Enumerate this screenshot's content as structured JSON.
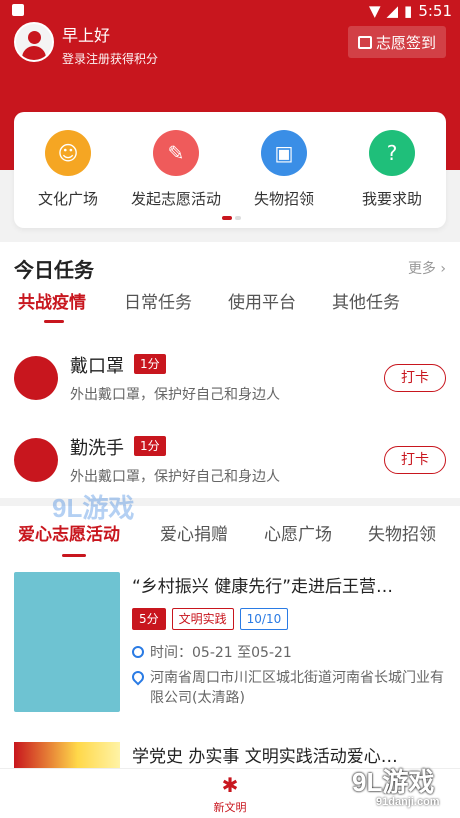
{
  "status": {
    "time": "5:51"
  },
  "header": {
    "greeting": "早上好",
    "subtitle": "登录注册获得积分",
    "sign_in_label": "志愿签到"
  },
  "quick_actions": [
    {
      "label": "文化广场",
      "icon": "chat-bubble-icon",
      "color": "#f5a623"
    },
    {
      "label": "发起志愿活动",
      "icon": "megaphone-icon",
      "color": "#ef5b5b"
    },
    {
      "label": "失物招领",
      "icon": "box-icon",
      "color": "#3a8ee6"
    },
    {
      "label": "我要求助",
      "icon": "help-chat-icon",
      "color": "#1fbf7a"
    }
  ],
  "today_tasks": {
    "title": "今日任务",
    "more": "更多",
    "tabs": [
      "共战疫情",
      "日常任务",
      "使用平台",
      "其他任务"
    ],
    "active_tab": 0,
    "items": [
      {
        "name": "戴口罩",
        "points": "1分",
        "desc": "外出戴口罩，保护好自己和身边人",
        "action": "打卡",
        "icon": "mask-icon"
      },
      {
        "name": "勤洗手",
        "points": "1分",
        "desc": "外出戴口罩，保护好自己和身边人",
        "action": "打卡",
        "icon": "handwash-icon"
      }
    ]
  },
  "activities": {
    "tabs": [
      "爱心志愿活动",
      "爱心捐赠",
      "心愿广场",
      "失物招领"
    ],
    "active_tab": 0,
    "items": [
      {
        "title": "“乡村振兴 健康先行”走进后王营…",
        "points": "5分",
        "category": "文明实践",
        "quota": "10/10",
        "time": "时间：05-21 至05-21",
        "address": "河南省周口市川汇区城北街道河南省长城门业有限公司(太清路)"
      },
      {
        "title": "学党史 办实事 文明实践活动爱心…"
      }
    ]
  },
  "bottom_nav": {
    "label": "新文明"
  },
  "watermark": {
    "top": "9L游戏",
    "bottom": "9L游戏",
    "url": "91danji.com"
  }
}
